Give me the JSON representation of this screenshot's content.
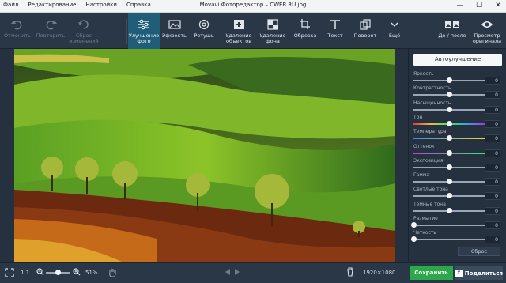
{
  "window": {
    "title": "Movavi Фоторедактор – CWER.RU.jpg",
    "menu": [
      "Файл",
      "Редактирование",
      "Настройки",
      "Справка"
    ],
    "controls": [
      "—",
      "☐",
      "✕"
    ]
  },
  "toolbar": {
    "undo": "Отменить",
    "redo": "Повторить",
    "reset": "Сброс изменений",
    "enhance": "Улучшение фото",
    "effects": "Эффекты",
    "retouch": "Ретушь",
    "remove_objects": "Удаление объектов",
    "remove_bg": "Удаление фона",
    "crop": "Обрезка",
    "text": "Текст",
    "rotate": "Поворот",
    "more": "Ещё",
    "before_after": "До / после",
    "view_original": "Просмотр оригинала"
  },
  "panel": {
    "auto_enhance": "Автоулучшение",
    "sliders": [
      {
        "name": "Яркость",
        "value": "0",
        "level": 0.5
      },
      {
        "name": "Контрастность",
        "value": "0",
        "level": 0.5
      },
      {
        "name": "Насыщенность",
        "value": "0",
        "level": 0.5
      },
      {
        "name": "Тон",
        "value": "0",
        "level": 0.5
      },
      {
        "name": "Температура",
        "value": "0",
        "level": 0.5
      },
      {
        "name": "Оттенок",
        "value": "0",
        "level": 0.5
      },
      {
        "name": "Экспозиция",
        "value": "0",
        "level": 0.5
      },
      {
        "name": "Гамма",
        "value": "0",
        "level": 0.5
      },
      {
        "name": "Светлые тона",
        "value": "0",
        "level": 0.5
      },
      {
        "name": "Темные тона",
        "value": "0",
        "level": 0.5
      },
      {
        "name": "Размытие",
        "value": "0",
        "level": 0.0
      },
      {
        "name": "Четкость",
        "value": "0",
        "level": 0.0
      }
    ],
    "reset": "Сброс"
  },
  "bottom": {
    "fit_icon": "fit-screen-icon",
    "ratio": "1:1",
    "zoom": "51%",
    "zoom_level": 0.51,
    "dimensions": "1920×1080",
    "save": "Сохранить",
    "share": "Поделиться",
    "share_icon": "f"
  },
  "colors": {
    "accent": "#1f5d79",
    "save": "#2aa84a"
  }
}
